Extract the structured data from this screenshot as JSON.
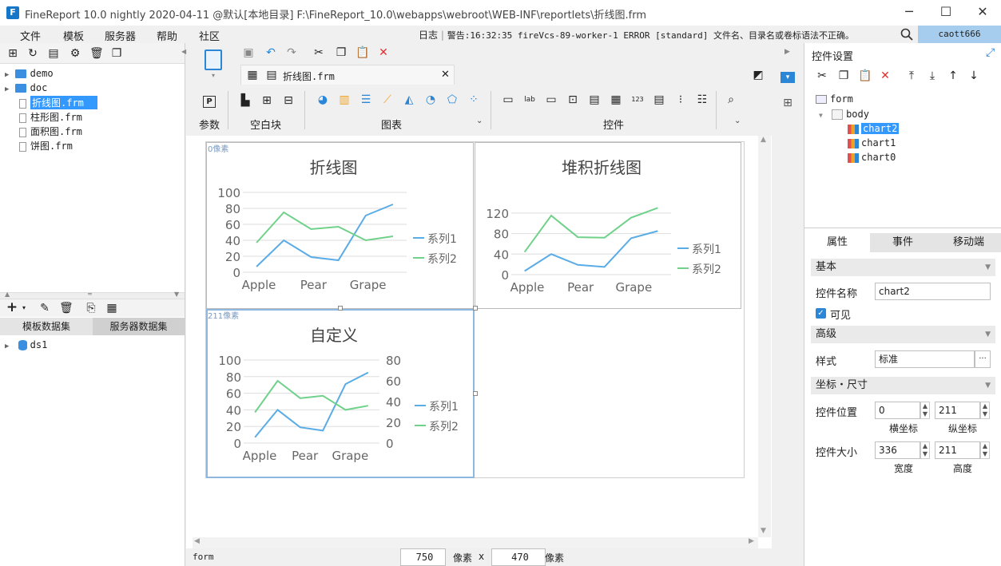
{
  "window": {
    "title": "FineReport 10.0 nightly 2020-04-11 @默认[本地目录]     F:\\FineReport_10.0\\webapps\\webroot\\WEB-INF\\reportlets\\折线图.frm",
    "minimize": "─",
    "maximize": "☐",
    "close": "✕"
  },
  "menu": {
    "items": [
      "文件",
      "模板",
      "服务器",
      "帮助",
      "社区"
    ],
    "log_label": "日志",
    "warning": "警告:16:32:35 fireVcs-89-worker-1 ERROR [standard] 文件名、目录名或卷标语法不正确。",
    "user": "caott666"
  },
  "file_tree": [
    {
      "type": "folder",
      "label": "demo"
    },
    {
      "type": "folder",
      "label": "doc"
    },
    {
      "type": "file",
      "label": "折线图.frm",
      "selected": true
    },
    {
      "type": "file",
      "label": "柱形图.frm"
    },
    {
      "type": "file",
      "label": "面积图.frm"
    },
    {
      "type": "file",
      "label": "饼图.frm"
    }
  ],
  "dataset_tabs": [
    "模板数据集",
    "服务器数据集"
  ],
  "datasets": [
    "ds1"
  ],
  "editor_tab": "折线图.frm",
  "ribbon": {
    "groups": [
      "参数",
      "空白块",
      "图表",
      "控件"
    ],
    "param_icon": "P"
  },
  "canvas": {
    "top_label": "0像素",
    "mid_label": "211像素"
  },
  "charts": [
    {
      "title": "折线图",
      "categories": [
        "Apple",
        "Pear",
        "Grape"
      ],
      "yticks": [
        "100",
        "80",
        "60",
        "40",
        "20",
        "0"
      ],
      "series": [
        {
          "name": "系列1",
          "color": "#5aace6"
        },
        {
          "name": "系列2",
          "color": "#6fd18a"
        }
      ]
    },
    {
      "title": "堆积折线图",
      "categories": [
        "Apple",
        "Pear",
        "Grape"
      ],
      "yticks": [
        "120",
        "80",
        "40",
        "0"
      ],
      "series": [
        {
          "name": "系列1",
          "color": "#5aace6"
        },
        {
          "name": "系列2",
          "color": "#6fd18a"
        }
      ]
    },
    {
      "title": "自定义",
      "categories": [
        "Apple",
        "Pear",
        "Grape"
      ],
      "yticks": [
        "100",
        "80",
        "60",
        "40",
        "20",
        "0"
      ],
      "y2ticks": [
        "80",
        "60",
        "40",
        "20",
        "0"
      ],
      "series": [
        {
          "name": "系列1",
          "color": "#5aace6"
        },
        {
          "name": "系列2",
          "color": "#6fd18a"
        }
      ]
    }
  ],
  "chart_data": [
    {
      "type": "line",
      "title": "折线图",
      "x": [
        "Apple",
        "",
        "Pear",
        "",
        "Grape",
        ""
      ],
      "ylim": [
        0,
        100
      ],
      "series": [
        {
          "name": "系列1",
          "values": [
            7,
            40,
            19,
            15,
            71,
            85
          ]
        },
        {
          "name": "系列2",
          "values": [
            37,
            75,
            54,
            57,
            40,
            45
          ]
        }
      ]
    },
    {
      "type": "line",
      "title": "堆积折线图",
      "x": [
        "Apple",
        "",
        "Pear",
        "",
        "Grape",
        ""
      ],
      "ylim": [
        0,
        140
      ],
      "series": [
        {
          "name": "系列1",
          "values": [
            7,
            40,
            19,
            15,
            71,
            85
          ]
        },
        {
          "name": "系列2",
          "values": [
            44,
            115,
            73,
            72,
            111,
            130
          ]
        }
      ]
    },
    {
      "type": "line",
      "title": "自定义",
      "x": [
        "Apple",
        "",
        "Pear",
        "",
        "Grape",
        ""
      ],
      "ylim": [
        0,
        100
      ],
      "series": [
        {
          "name": "系列1",
          "values": [
            7,
            40,
            19,
            15,
            71,
            85
          ]
        },
        {
          "name": "系列2",
          "values": [
            37,
            75,
            54,
            57,
            40,
            45
          ]
        }
      ]
    }
  ],
  "status": {
    "left": "form",
    "width": "750",
    "unit1": "像素",
    "x": "x",
    "height": "470",
    "unit2": "像素"
  },
  "right": {
    "title": "控件设置",
    "tree": {
      "root": "form",
      "body": "body",
      "items": [
        "chart2",
        "chart1",
        "chart0"
      ]
    },
    "tabs": [
      "属性",
      "事件",
      "移动端"
    ],
    "sections": {
      "basic": "基本",
      "advanced": "高级",
      "coords": "坐标・尺寸"
    },
    "name_label": "控件名称",
    "name_value": "chart2",
    "visible_label": "可见",
    "style_label": "样式",
    "style_value": "标准",
    "more": "···",
    "pos_label": "控件位置",
    "pos_x": "0",
    "pos_y": "211",
    "x_label": "横坐标",
    "y_label": "纵坐标",
    "size_label": "控件大小",
    "size_w": "336",
    "size_h": "211",
    "w_label": "宽度",
    "h_label": "高度"
  }
}
